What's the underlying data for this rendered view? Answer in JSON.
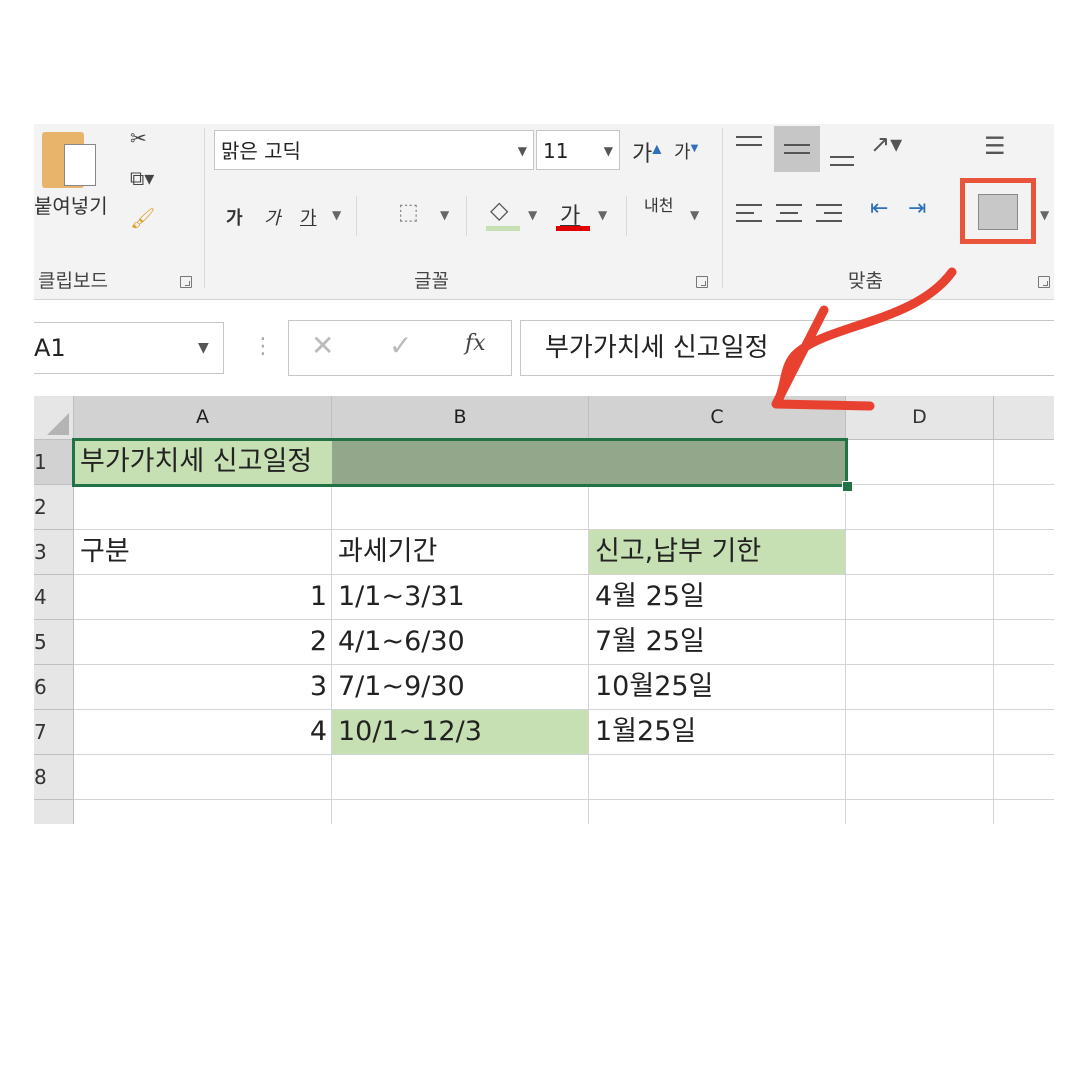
{
  "ribbon": {
    "clipboard": {
      "paste_label": "붙여넣기",
      "group_label": "클립보드"
    },
    "font": {
      "font_name": "맑은 고딕",
      "font_size": "11",
      "grow_label": "가",
      "shrink_label": "가",
      "bold_label": "가",
      "italic_label": "가",
      "underline_label": "가",
      "font_color_label": "가",
      "phonetic_label": "내천",
      "group_label": "글꼴",
      "fill_color": "#c6e0b4",
      "font_color": "#e00000"
    },
    "alignment": {
      "group_label": "맞춤",
      "highlight_color": "#e8553a"
    }
  },
  "formula_bar": {
    "name_box": "A1",
    "fx": "fx",
    "formula": "부가가치세 신고일정"
  },
  "columns": [
    "A",
    "B",
    "C",
    "D"
  ],
  "rows": [
    "1",
    "2",
    "3",
    "4",
    "5",
    "6",
    "7",
    "8"
  ],
  "cells": {
    "A1": "부가가치세 신고일정",
    "A3": "구분",
    "B3": "과세기간",
    "C3": "신고,납부 기한",
    "A4": "1",
    "B4": "1/1~3/31",
    "C4": "4월 25일",
    "A5": "2",
    "B5": "4/1~6/30",
    "C5": "7월 25일",
    "A6": "3",
    "B6": "7/1~9/30",
    "C6": "10월25일",
    "A7": "4",
    "B7": "10/1~12/3",
    "C7": "1월25일"
  },
  "colors": {
    "cell_green": "#c6e0b4",
    "selection": "#217346",
    "arrow": "#e8412f"
  }
}
